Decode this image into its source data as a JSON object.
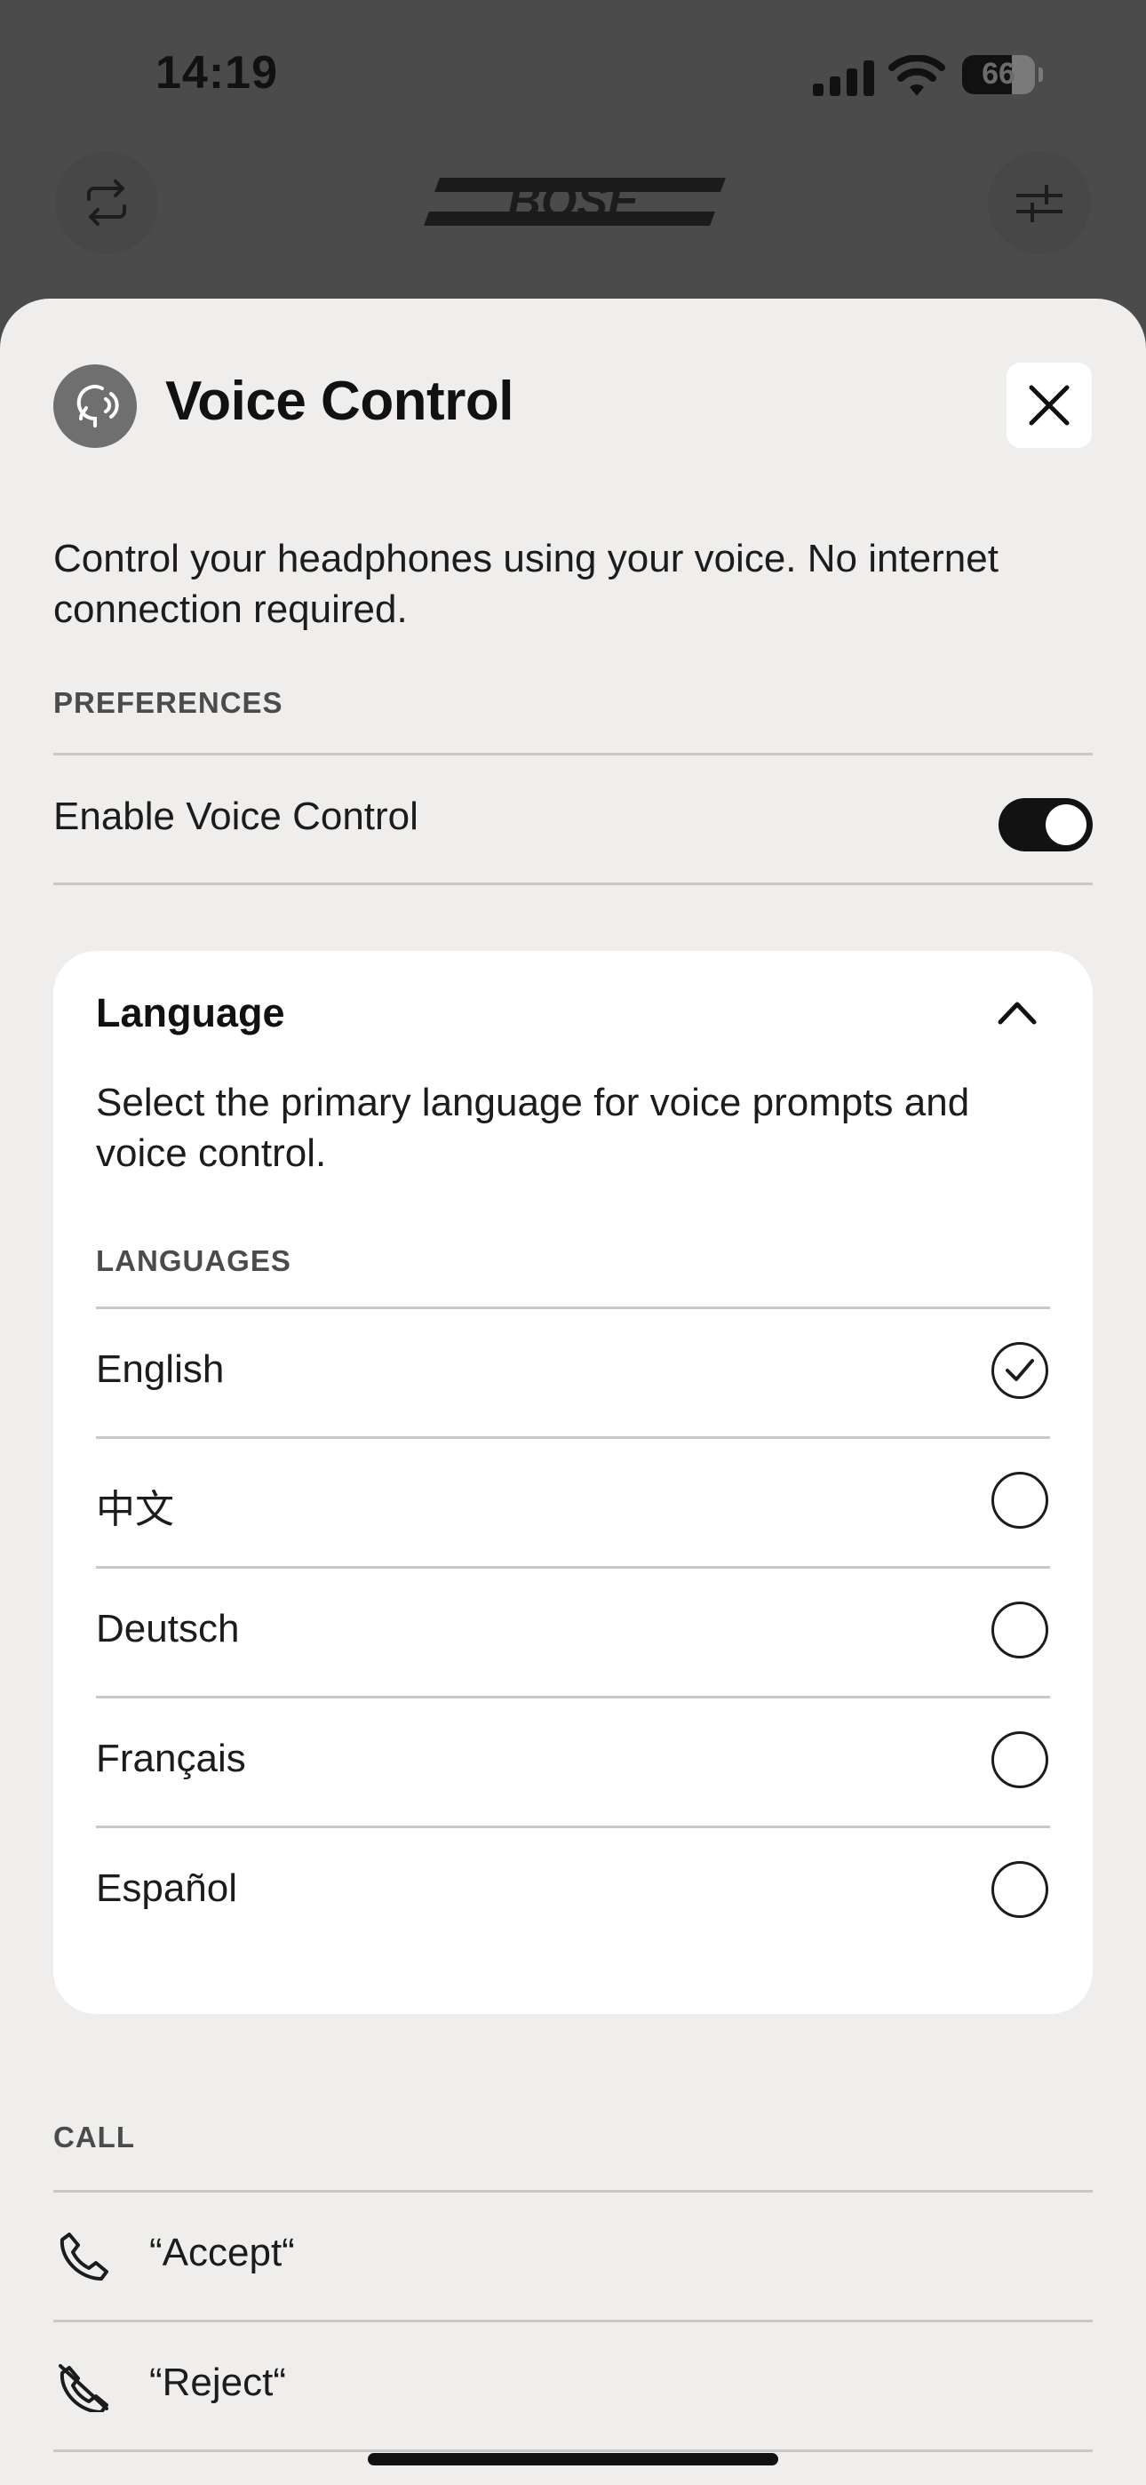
{
  "status_bar": {
    "time": "14:19",
    "battery": "66"
  },
  "header": {
    "brand": "BOSE"
  },
  "sheet": {
    "title": "Voice Control",
    "description": "Control your headphones using your voice. No internet connection required.",
    "preferences_label": "PREFERENCES",
    "enable_label": "Enable Voice Control",
    "enable_on": true
  },
  "language": {
    "title": "Language",
    "description": "Select the primary language for voice prompts and voice control.",
    "list_label": "LANGUAGES",
    "options": [
      {
        "label": "English",
        "selected": true
      },
      {
        "label": "中文",
        "selected": false
      },
      {
        "label": "Deutsch",
        "selected": false
      },
      {
        "label": "Français",
        "selected": false
      },
      {
        "label": "Español",
        "selected": false
      }
    ]
  },
  "call": {
    "label": "CALL",
    "items": [
      {
        "label": "“Accept“",
        "icon": "phone-icon"
      },
      {
        "label": "“Reject“",
        "icon": "phone-off-icon"
      }
    ]
  },
  "colors": {
    "toggle_on": "#121212",
    "sheet_bg": "#efeeed",
    "card_bg": "#ffffff"
  }
}
